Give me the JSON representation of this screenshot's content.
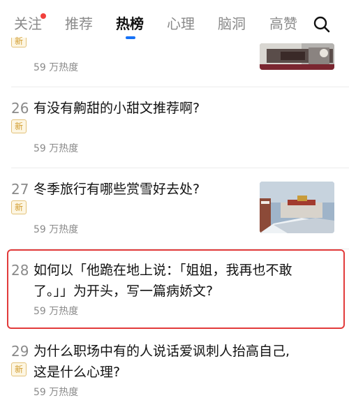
{
  "tabs": [
    {
      "label": "关注"
    },
    {
      "label": "推荐"
    },
    {
      "label": "热榜"
    },
    {
      "label": "心理"
    },
    {
      "label": "脑洞"
    },
    {
      "label": "高赞"
    }
  ],
  "active_tab": "热榜",
  "items": [
    {
      "rank": "",
      "title_lines": [],
      "badge": "新",
      "heat": "59 万热度"
    },
    {
      "rank": "26",
      "title_lines": [
        "有没有齁甜的小甜文推荐啊?"
      ],
      "badge": "新",
      "heat": "59 万热度"
    },
    {
      "rank": "27",
      "title_lines": [
        "冬季旅行有哪些赏雪好去处?"
      ],
      "badge": "新",
      "heat": "59 万热度"
    },
    {
      "rank": "28",
      "title_lines": [
        "如何以「他跪在地上说：「姐姐，我再也不敢",
        "了。」」为开头，写一篇病娇文?"
      ],
      "badge": "",
      "heat": "59 万热度"
    },
    {
      "rank": "29",
      "title_lines": [
        "为什么职场中有的人说话爱讽刺人抬高自己,",
        "这是什么心理?"
      ],
      "badge": "新",
      "heat": "59 万热度"
    }
  ]
}
